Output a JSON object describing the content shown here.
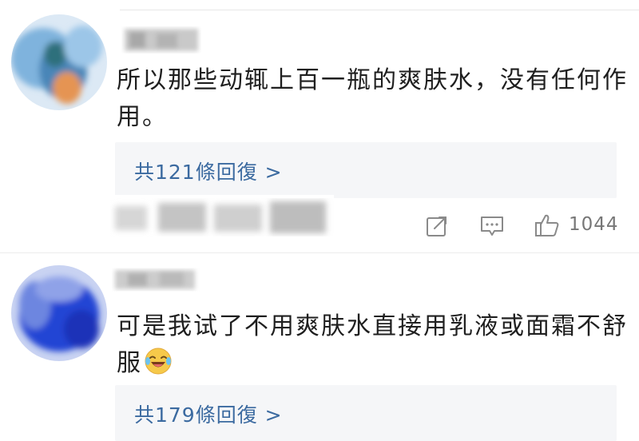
{
  "comments": [
    {
      "text": "所以那些动辄上百一瓶的爽肤水，没有任何作用。",
      "replies_label": "共121條回復 >",
      "like_count": "1044",
      "avatar_colors": [
        "#5b9bd5",
        "#e08a4a",
        "#2e6e8a"
      ]
    },
    {
      "text": "可是我试了不用爽肤水直接用乳液或面霜不舒服",
      "emoji": "laughing-crying-emoji",
      "replies_label": "共179條回復 >",
      "avatar_colors": [
        "#1f3fd0",
        "#3b5bd9",
        "#6e8ae0"
      ]
    }
  ],
  "icons": {
    "share": "share-icon",
    "comment": "comment-icon",
    "like": "thumbs-up-icon"
  },
  "colors": {
    "link": "#3b6aa0",
    "reply_bg": "#f5f6f8",
    "muted": "#777777"
  }
}
